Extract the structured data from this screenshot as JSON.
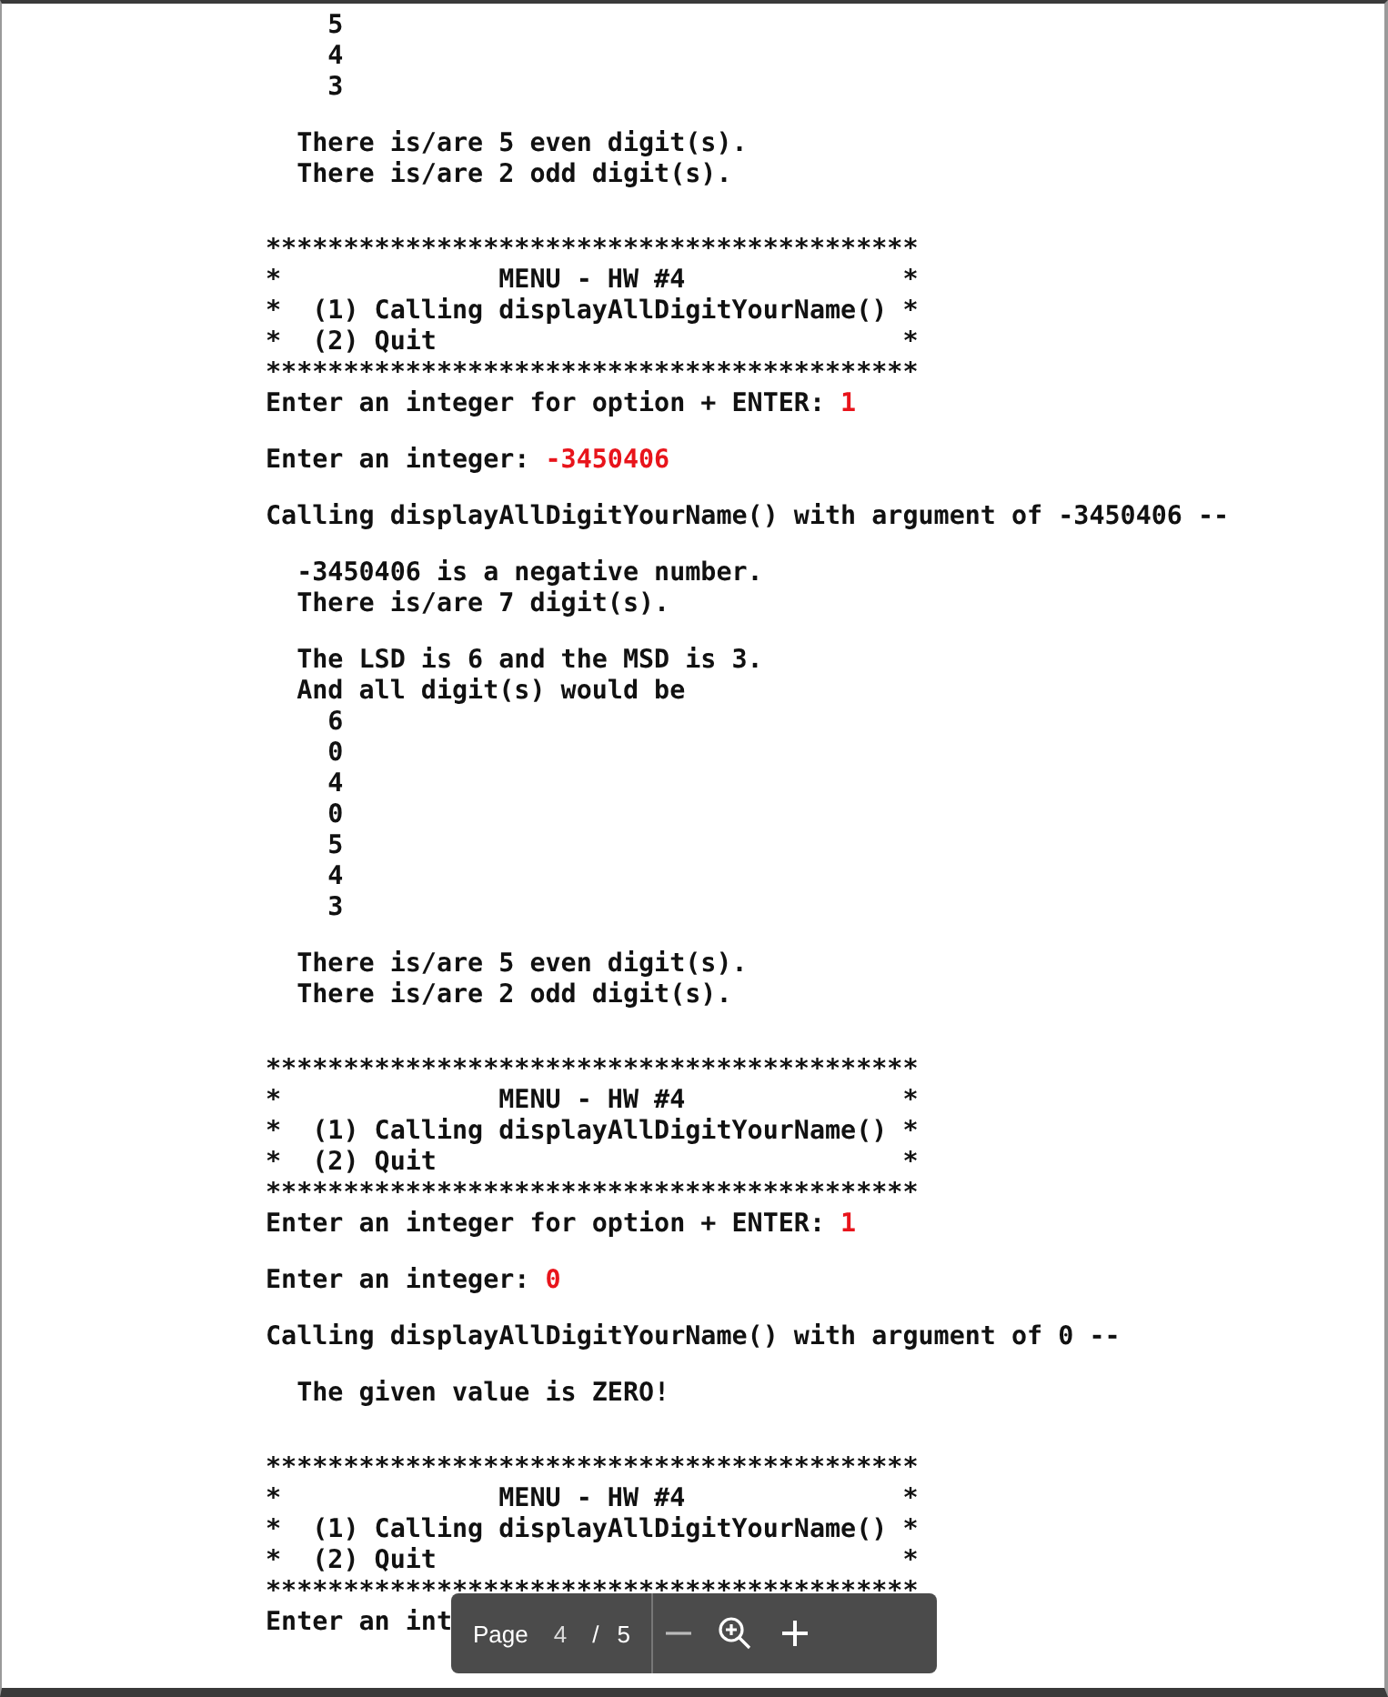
{
  "document": {
    "blocks": [
      {
        "kind": "output",
        "lines": [
          {
            "text": "    5"
          },
          {
            "text": "    4"
          },
          {
            "text": "    3"
          }
        ]
      },
      {
        "kind": "output",
        "lines": [
          {
            "text": "  There is/are 5 even digit(s)."
          },
          {
            "text": "  There is/are 2 odd digit(s)."
          }
        ]
      },
      {
        "kind": "menu",
        "lines": [
          {
            "text": "******************************************"
          },
          {
            "text": "*              MENU - HW #4              *"
          },
          {
            "text": "*  (1) Calling displayAllDigitYourName() *"
          },
          {
            "text": "*  (2) Quit                              *"
          },
          {
            "text": "******************************************"
          },
          {
            "text": "Enter an integer for option + ENTER: ",
            "input": "1"
          }
        ]
      },
      {
        "kind": "output",
        "lines": [
          {
            "text": "Enter an integer: ",
            "input": "-3450406"
          }
        ]
      },
      {
        "kind": "output",
        "lines": [
          {
            "text": "Calling displayAllDigitYourName() with argument of -3450406 --"
          }
        ]
      },
      {
        "kind": "output",
        "lines": [
          {
            "text": "  -3450406 is a negative number."
          },
          {
            "text": "  There is/are 7 digit(s)."
          }
        ]
      },
      {
        "kind": "output",
        "lines": [
          {
            "text": "  The LSD is 6 and the MSD is 3."
          },
          {
            "text": "  And all digit(s) would be"
          },
          {
            "text": "    6"
          },
          {
            "text": "    0"
          },
          {
            "text": "    4"
          },
          {
            "text": "    0"
          },
          {
            "text": "    5"
          },
          {
            "text": "    4"
          },
          {
            "text": "    3"
          }
        ]
      },
      {
        "kind": "output",
        "lines": [
          {
            "text": "  There is/are 5 even digit(s)."
          },
          {
            "text": "  There is/are 2 odd digit(s)."
          }
        ]
      },
      {
        "kind": "menu",
        "lines": [
          {
            "text": "******************************************"
          },
          {
            "text": "*              MENU - HW #4              *"
          },
          {
            "text": "*  (1) Calling displayAllDigitYourName() *"
          },
          {
            "text": "*  (2) Quit                              *"
          },
          {
            "text": "******************************************"
          },
          {
            "text": "Enter an integer for option + ENTER: ",
            "input": "1"
          }
        ]
      },
      {
        "kind": "output",
        "lines": [
          {
            "text": "Enter an integer: ",
            "input": "0"
          }
        ]
      },
      {
        "kind": "output",
        "lines": [
          {
            "text": "Calling displayAllDigitYourName() with argument of 0 --"
          }
        ]
      },
      {
        "kind": "output",
        "lines": [
          {
            "text": "  The given value is ZERO!"
          }
        ]
      },
      {
        "kind": "menu",
        "lines": [
          {
            "text": "******************************************"
          },
          {
            "text": "*              MENU - HW #4              *"
          },
          {
            "text": "*  (1) Calling displayAllDigitYourName() *"
          },
          {
            "text": "*  (2) Quit                              *"
          },
          {
            "text": "******************************************"
          },
          {
            "text": "Enter an int"
          }
        ]
      }
    ]
  },
  "viewer_toolbar": {
    "page_label": "Page",
    "current_page": "4",
    "separator": "/",
    "page_count": "5"
  }
}
